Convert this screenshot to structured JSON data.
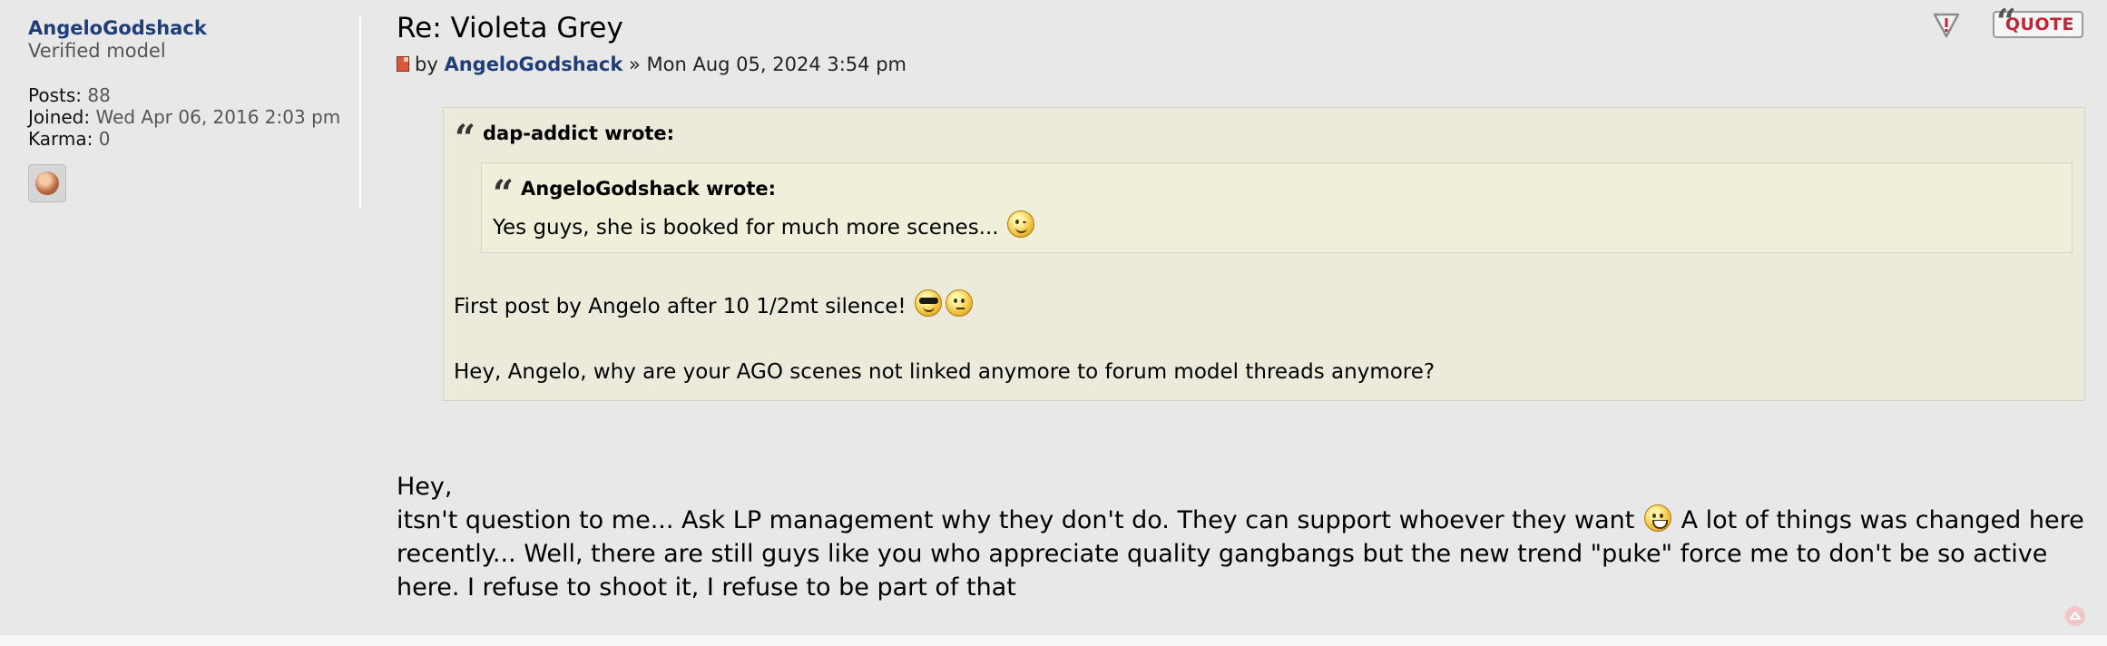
{
  "profile": {
    "username": "AngeloGodshack",
    "rank": "Verified model",
    "posts_label": "Posts:",
    "posts_value": "88",
    "joined_label": "Joined:",
    "joined_value": "Wed Apr 06, 2016 2:03 pm",
    "karma_label": "Karma:",
    "karma_value": "0"
  },
  "post": {
    "title": "Re: Violeta Grey",
    "by": "by",
    "author": "AngeloGodshack",
    "separator": "»",
    "date": "Mon Aug 05, 2024 3:54 pm",
    "quote_button": "QUOTE"
  },
  "quote_outer": {
    "cite": "dap-addict wrote:",
    "line1": "First post by Angelo after 10 1/2mt silence!",
    "line2": "Hey, Angelo, why are your AGO scenes not linked anymore to forum model threads anymore?"
  },
  "quote_inner": {
    "cite": "AngeloGodshack wrote:",
    "text": "Yes guys, she is booked for much more scenes..."
  },
  "body": {
    "line1": "Hey,",
    "line2a": "itsn't question to me... Ask LP management why they don't do. They can support whoever they want",
    "line2b": "A lot of things was changed here recently... Well, there are still guys like you who appreciate quality gangbangs but the new trend \"puke\" force me to don't be so active here. I refuse to shoot it, I refuse to be part of that"
  },
  "icons": {
    "report": "report-icon",
    "quote": "quote-icon",
    "post_doc": "post-document-icon",
    "back_to_top": "back-to-top-icon"
  },
  "colors": {
    "username": "#1f3e78",
    "quote_button_text": "#c0263a",
    "background": "#e8e8e8",
    "quote_bg": "#ebeadb"
  }
}
